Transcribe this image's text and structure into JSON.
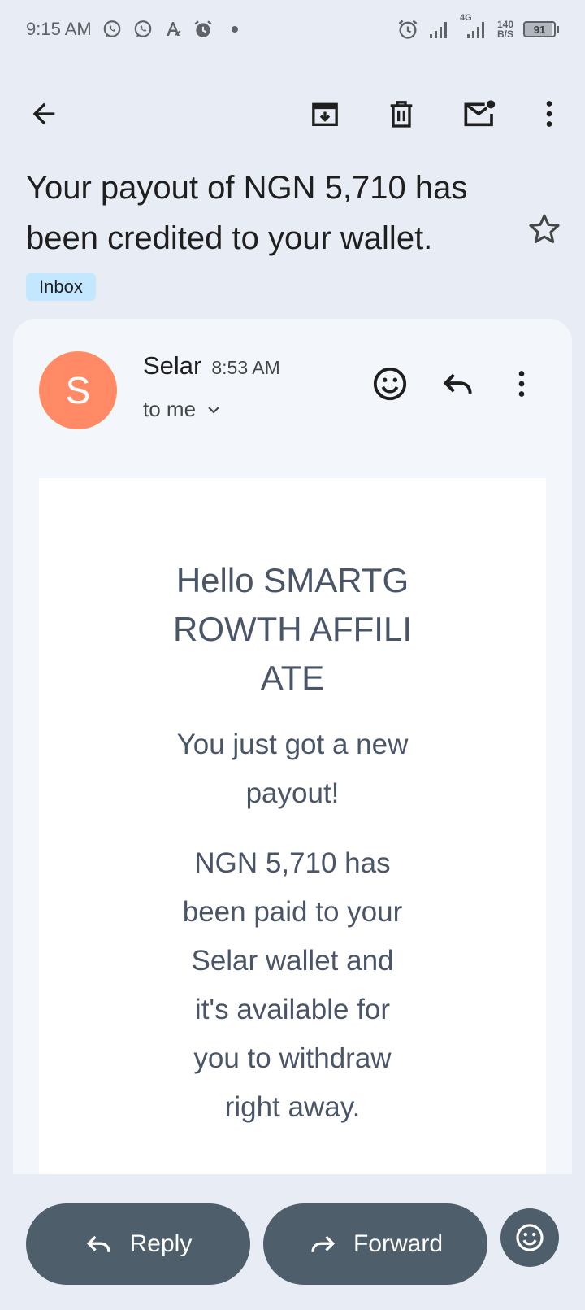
{
  "status_bar": {
    "time": "9:15 AM",
    "network_type": "4G",
    "speed_value": "140",
    "speed_unit": "B/S",
    "battery_level": "91"
  },
  "email": {
    "subject": "Your payout of NGN 5,710 has been credited to your wallet.",
    "label": "Inbox",
    "sender_initial": "S",
    "sender_name": "Selar",
    "time": "8:53 AM",
    "recipient": "to me"
  },
  "body": {
    "greeting": "Hello SMARTGROWTH AFFILIATE",
    "line1": "You just got a new payout!",
    "line2": "NGN 5,710 has been paid to your Selar wallet and it's available for you to withdraw right away."
  },
  "actions": {
    "reply_label": "Reply",
    "forward_label": "Forward"
  },
  "colors": {
    "background": "#e8edf5",
    "avatar": "#ff8a65",
    "label_chip": "#c2e7ff",
    "action_button": "#4f5e6b"
  }
}
